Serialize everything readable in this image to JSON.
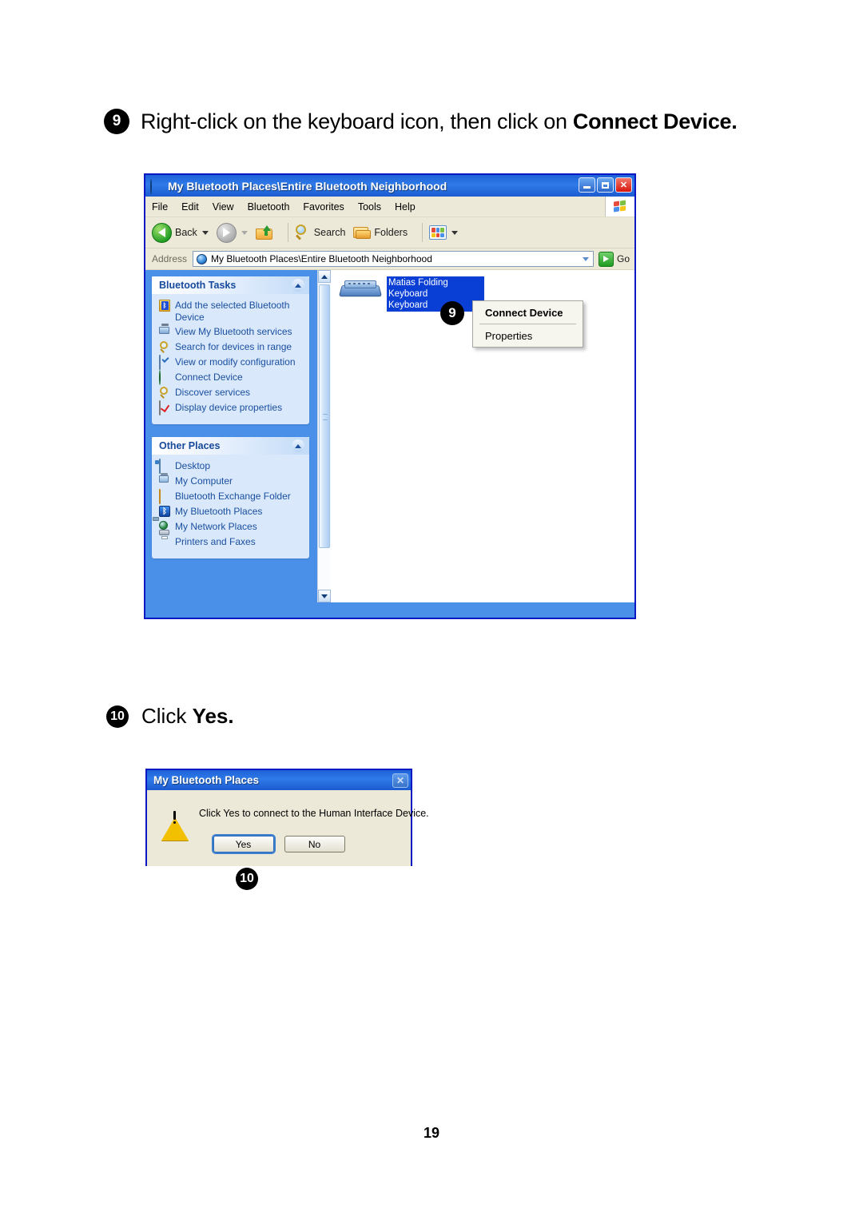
{
  "document": {
    "page_number": "19"
  },
  "steps": [
    {
      "number": "9",
      "text_prefix": "Right-click on the keyboard icon, then click on ",
      "text_bold": "Connect Device."
    },
    {
      "number": "10",
      "text_prefix": "Click ",
      "text_bold": "Yes."
    }
  ],
  "explorer_window": {
    "title": "My Bluetooth Places\\Entire Bluetooth Neighborhood",
    "title_icon": "bluetooth-globe-icon",
    "window_buttons": {
      "minimize": "minimize-button",
      "maximize": "maximize-button",
      "close": "close-button"
    },
    "menu": [
      "File",
      "Edit",
      "View",
      "Bluetooth",
      "Favorites",
      "Tools",
      "Help"
    ],
    "toolbar": {
      "back_label": "Back",
      "forward_label": "",
      "up_label": "",
      "search_label": "Search",
      "folders_label": "Folders",
      "views_label": ""
    },
    "address_bar": {
      "label": "Address",
      "value": "My Bluetooth Places\\Entire Bluetooth Neighborhood",
      "go_label": "Go"
    },
    "sidebar": {
      "panels": [
        {
          "title": "Bluetooth Tasks",
          "items": [
            {
              "label": "Add the selected Bluetooth Device",
              "icon": "add-bluetooth-device-icon"
            },
            {
              "label": "View My Bluetooth services",
              "icon": "bluetooth-services-icon"
            },
            {
              "label": "Search for devices in range",
              "icon": "search-magnifier-icon"
            },
            {
              "label": "View or modify configuration",
              "icon": "configuration-icon"
            },
            {
              "label": "Connect Device",
              "icon": "connect-device-globe-icon"
            },
            {
              "label": "Discover services",
              "icon": "discover-magnifier-icon"
            },
            {
              "label": "Display device properties",
              "icon": "device-properties-icon"
            }
          ]
        },
        {
          "title": "Other Places",
          "items": [
            {
              "label": "Desktop",
              "icon": "desktop-icon"
            },
            {
              "label": "My Computer",
              "icon": "my-computer-icon"
            },
            {
              "label": "Bluetooth Exchange Folder",
              "icon": "folder-icon"
            },
            {
              "label": "My Bluetooth Places",
              "icon": "bluetooth-icon"
            },
            {
              "label": "My Network Places",
              "icon": "network-places-icon"
            },
            {
              "label": "Printers and Faxes",
              "icon": "printer-icon"
            }
          ]
        }
      ]
    },
    "content": {
      "device": {
        "name_line1": "Matias Folding Keyboard",
        "name_line2": "Keyboard",
        "icon": "bluetooth-keyboard-icon",
        "selected": true
      },
      "context_menu": {
        "items": [
          {
            "label": "Connect Device",
            "bold": true
          },
          {
            "label": "Properties",
            "bold": false
          }
        ]
      },
      "callout_badge": "9"
    }
  },
  "dialog": {
    "title": "My Bluetooth Places",
    "close_label": "✕",
    "icon": "warning-triangle-icon",
    "message": "Click Yes to connect to the Human Interface Device.",
    "buttons": [
      {
        "label": "Yes",
        "default": true
      },
      {
        "label": "No",
        "default": false
      }
    ],
    "callout_badge": "10"
  },
  "colors": {
    "title_bar_blue": "#1e62d8",
    "window_border": "#0a17c4",
    "sidebar_blue": "#4a90e8",
    "panel_fill": "#d9e8fb",
    "panel_header_text": "#174a9c",
    "link_text": "#1a4fa0",
    "chrome_beige": "#ece9d8",
    "selection_blue": "#0a3fd6",
    "close_red": "#d5160d",
    "go_green": "#1f9b22",
    "warning_yellow": "#f2c000"
  }
}
